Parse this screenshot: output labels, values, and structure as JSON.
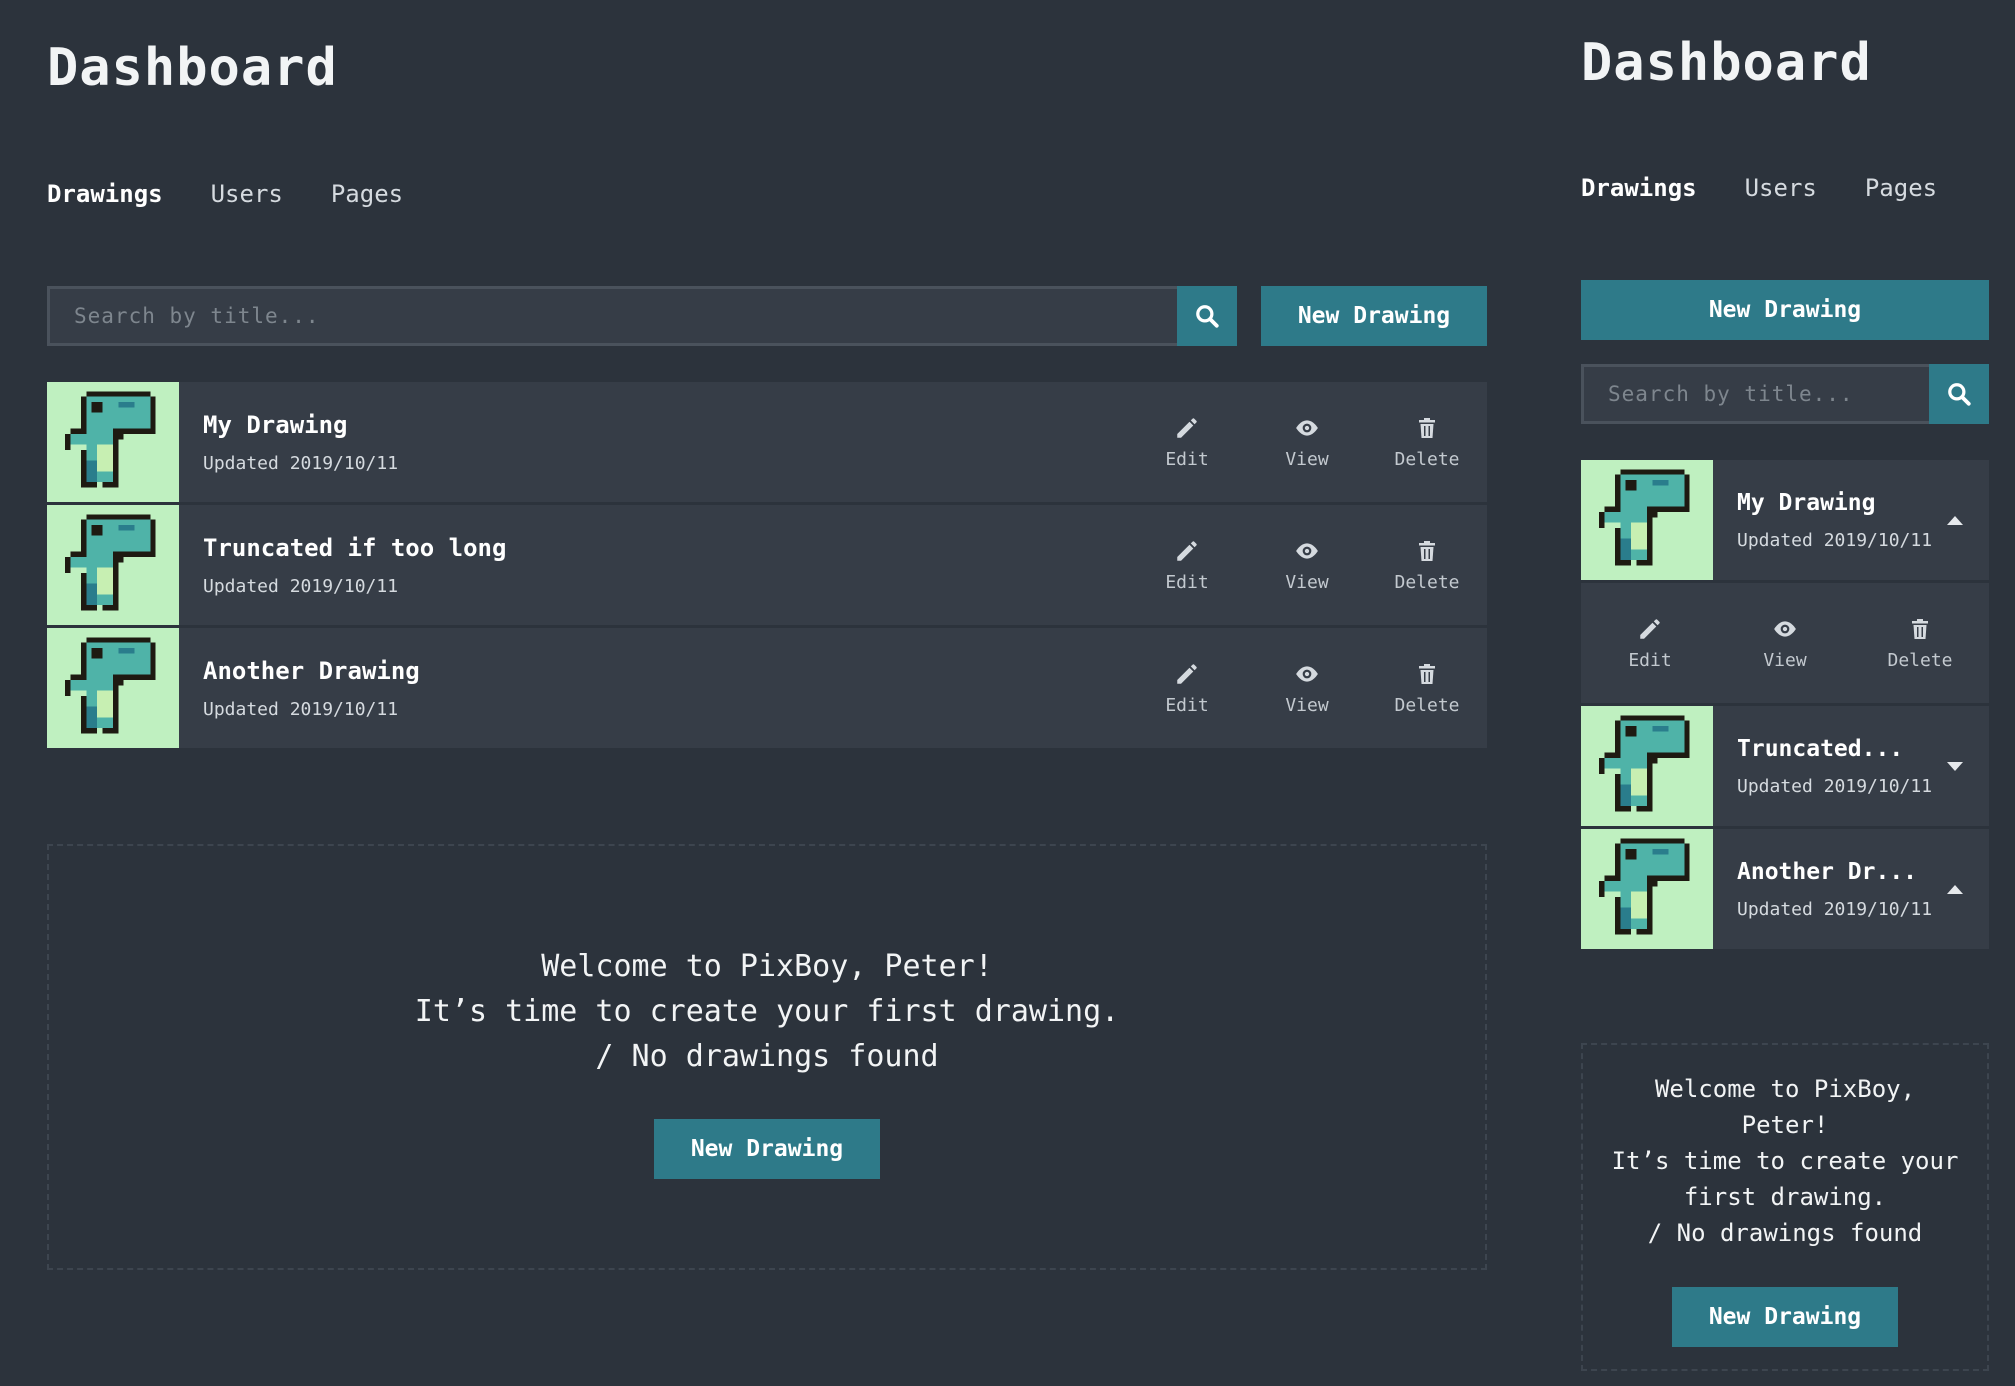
{
  "desktop": {
    "title": "Dashboard",
    "tabs": [
      "Drawings",
      "Users",
      "Pages"
    ],
    "search_placeholder": "Search by title...",
    "new_drawing_label": "New Drawing",
    "drawings": [
      {
        "name": "My Drawing",
        "updated": "Updated 2019/10/11"
      },
      {
        "name": "Truncated if too long",
        "updated": "Updated 2019/10/11"
      },
      {
        "name": "Another Drawing",
        "updated": "Updated 2019/10/11"
      }
    ],
    "actions": {
      "edit": "Edit",
      "view": "View",
      "delete": "Delete"
    },
    "empty": {
      "line1": "Welcome to PixBoy, Peter!",
      "line2": "It’s time to create your first drawing.",
      "line3": "/ No drawings found",
      "button": "New Drawing"
    }
  },
  "mobile": {
    "title": "Dashboard",
    "tabs": [
      "Drawings",
      "Users",
      "Pages"
    ],
    "new_drawing_label": "New Drawing",
    "search_placeholder": "Search by title...",
    "drawings": [
      {
        "name": "My Drawing",
        "updated": "Updated 2019/10/11",
        "expanded": true
      },
      {
        "name": "Truncated...",
        "updated": "Updated 2019/10/11",
        "expanded": false
      },
      {
        "name": "Another Dr...",
        "updated": "Updated 2019/10/11",
        "expanded": true
      }
    ],
    "actions": {
      "edit": "Edit",
      "view": "View",
      "delete": "Delete"
    },
    "empty": {
      "line1": "Welcome to PixBoy,",
      "line2": "Peter!",
      "line3": "It’s time to create your",
      "line4": "first drawing.",
      "line5": "/ No drawings found",
      "button": "New Drawing"
    }
  },
  "colors": {
    "background": "#2c333c",
    "row": "#363d47",
    "accent": "#2e7a89",
    "thumb_bg": "#bff0c0"
  },
  "icons": [
    "search-icon",
    "pencil-icon",
    "eye-icon",
    "trash-icon",
    "dino-thumbnail",
    "caret-up-icon",
    "caret-down-icon"
  ]
}
